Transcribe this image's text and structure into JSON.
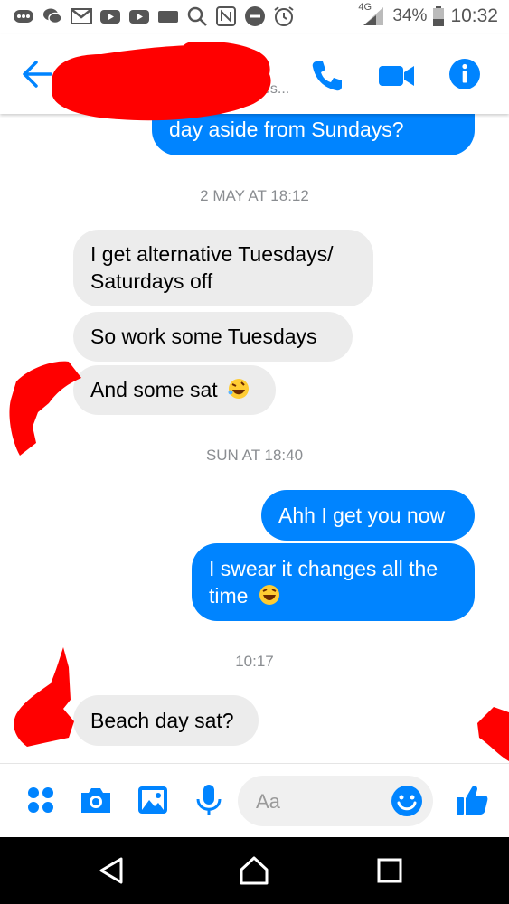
{
  "status_bar": {
    "left_icons": [
      "more-dots-icon",
      "wechat-icon",
      "gmail-icon",
      "youtube-icon",
      "youtube-icon",
      "video-icon",
      "search-icon",
      "nfc-icon",
      "do-not-disturb-icon",
      "alarm-icon"
    ],
    "network": "4G",
    "battery": "34%",
    "time": "10:32"
  },
  "header": {
    "subtitle_fragment": "es...",
    "back_icon": "back-arrow-icon",
    "call_icon": "phone-icon",
    "video_icon": "video-camera-icon",
    "info_icon": "info-icon"
  },
  "messages": {
    "m0": "day aside from Sundays?",
    "t1": "2 MAY AT 18:12",
    "m1_line1": "I get alternative Tuesdays/",
    "m1_line2": "Saturdays off",
    "m2": "So work some Tuesdays",
    "m3": "And some sat",
    "t2": "SUN AT 18:40",
    "m4": "Ahh I get you now",
    "m5_line1": "I swear it changes all the",
    "m5_line2": "time",
    "t3": "10:17",
    "m6": "Beach day sat?"
  },
  "composer": {
    "placeholder": "Aa",
    "icons": [
      "menu-grid-icon",
      "camera-icon",
      "gallery-icon",
      "microphone-icon",
      "emoji-icon",
      "thumbs-up-icon"
    ]
  },
  "nav": {
    "icons": [
      "back-triangle-icon",
      "home-icon",
      "recents-icon"
    ]
  },
  "colors": {
    "accent": "#0084ff",
    "incoming_bubble": "#ececec",
    "redaction": "#ff0000"
  }
}
